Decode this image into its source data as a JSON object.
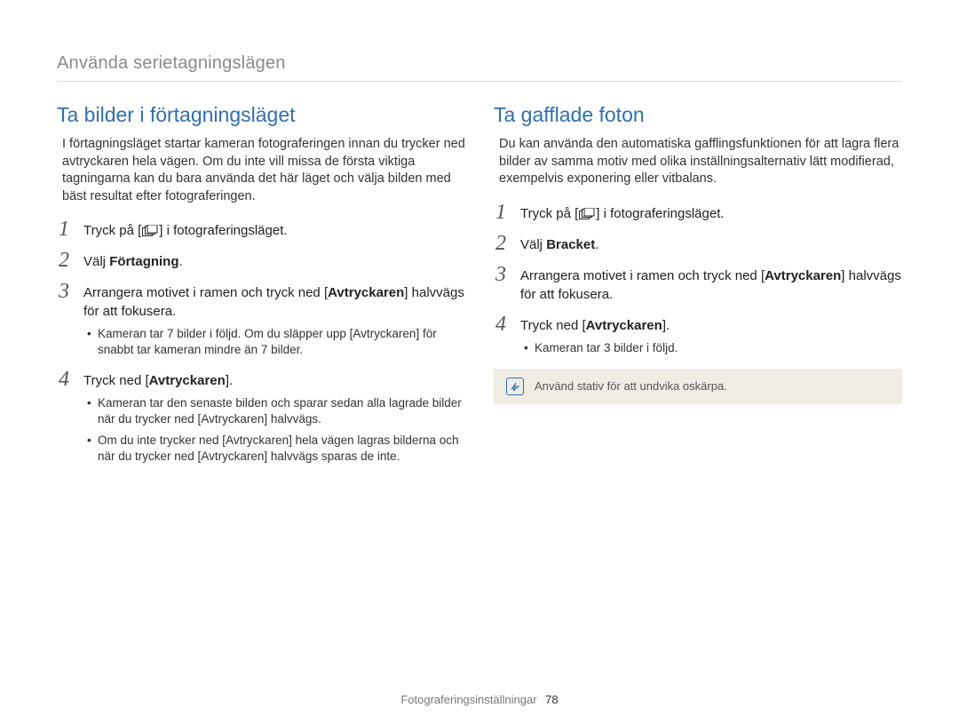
{
  "header": {
    "section_title": "Använda serietagningslägen"
  },
  "left": {
    "heading": "Ta bilder i förtagningsläget",
    "intro": "I förtagningsläget startar kameran fotograferingen innan du trycker ned avtryckaren hela vägen. Om du inte vill missa de första viktiga tagningarna kan du bara använda det här läget och välja bilden med bäst resultat efter fotograferingen.",
    "step1_prefix": "Tryck på [",
    "step1_suffix": "] i fotograferingsläget.",
    "step2_prefix": "Välj ",
    "step2_bold": "Förtagning",
    "step2_suffix": ".",
    "step3_a": "Arrangera motivet i ramen och tryck ned [",
    "step3_bold": "Avtryckaren",
    "step3_b": "] halvvägs för att fokusera.",
    "step3_sub1_a": "Kameran tar 7 bilder i följd. Om du släpper upp [",
    "step3_sub1_bold": "Avtryckaren",
    "step3_sub1_b": "] för snabbt tar kameran mindre än 7 bilder.",
    "step4_a": "Tryck ned [",
    "step4_bold": "Avtryckaren",
    "step4_b": "].",
    "step4_sub1_a": "Kameran tar den senaste bilden och sparar sedan alla lagrade bilder när du trycker ned [",
    "step4_sub1_bold": "Avtryckaren",
    "step4_sub1_b": "] halvvägs.",
    "step4_sub2_a": "Om du inte trycker ned [",
    "step4_sub2_bold1": "Avtryckaren",
    "step4_sub2_b": "] hela vägen lagras bilderna och när du trycker ned [",
    "step4_sub2_bold2": "Avtryckaren",
    "step4_sub2_c": "] halvvägs sparas de inte."
  },
  "right": {
    "heading": "Ta gafflade foton",
    "intro": "Du kan använda den automatiska gafflingsfunktionen för att lagra flera bilder av samma motiv med olika inställningsalternativ lätt modifierad, exempelvis exponering eller vitbalans.",
    "step1_prefix": "Tryck på [",
    "step1_suffix": "] i fotograferingsläget.",
    "step2_prefix": "Välj ",
    "step2_bold": "Bracket",
    "step2_suffix": ".",
    "step3_a": "Arrangera motivet i ramen och tryck ned [",
    "step3_bold": "Avtryckaren",
    "step3_b": "] halvvägs för att fokusera.",
    "step4_a": "Tryck ned [",
    "step4_bold": "Avtryckaren",
    "step4_b": "].",
    "step4_sub1": "Kameran tar 3 bilder i följd.",
    "note": "Använd stativ för att undvika oskärpa."
  },
  "footer": {
    "label": "Fotograferingsinställningar",
    "page": "78"
  },
  "icons": {
    "burst": "burst-icon",
    "note": "note-icon"
  }
}
